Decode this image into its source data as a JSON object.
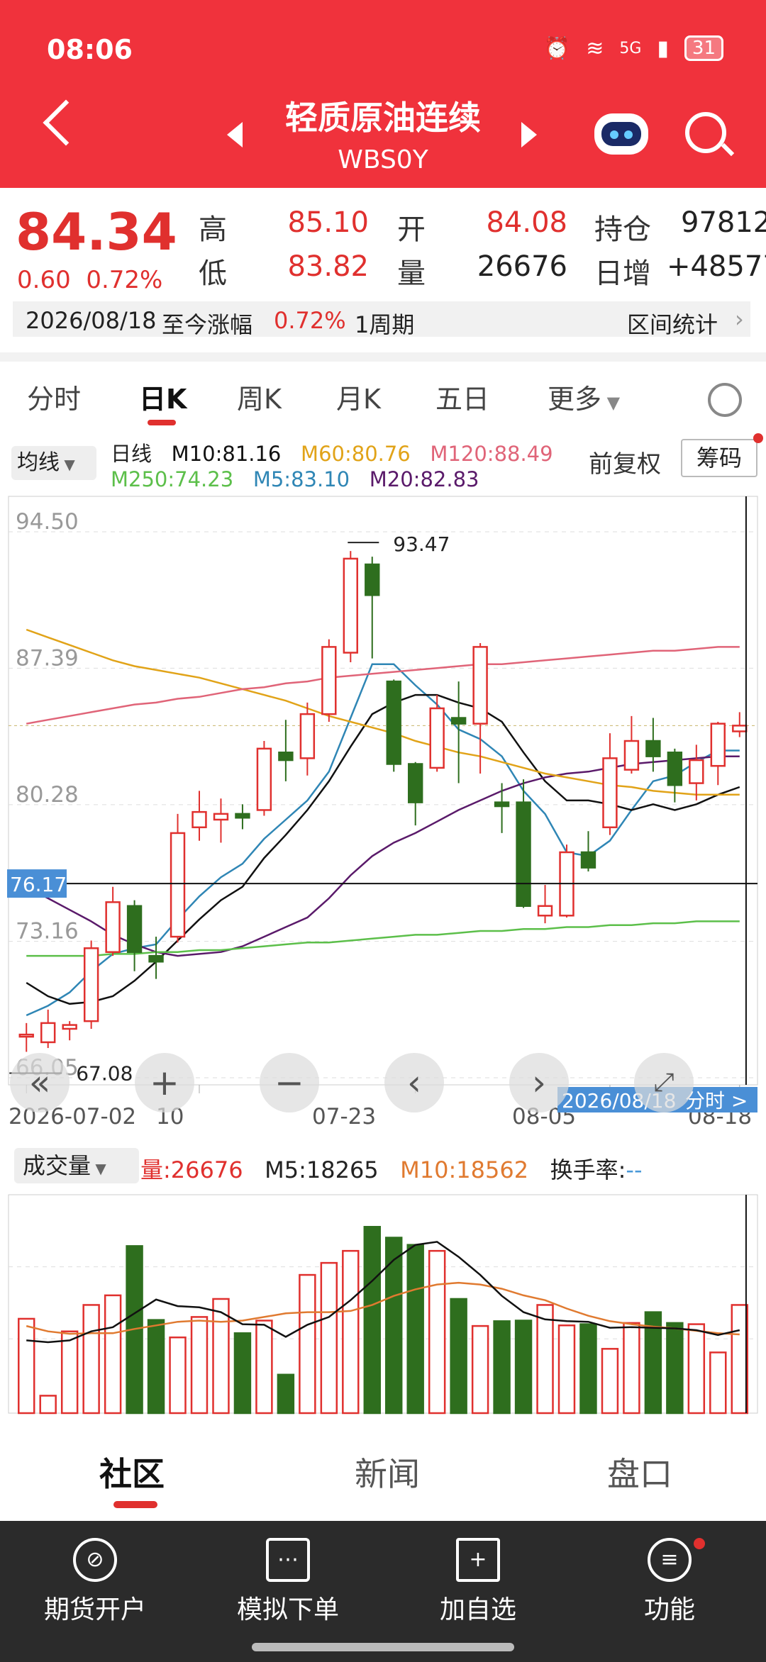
{
  "status": {
    "time": "08:06",
    "battery": "31",
    "network": "5G"
  },
  "header": {
    "title": "轻质原油连续",
    "code": "WBS0Y"
  },
  "quote": {
    "price": "84.34",
    "change": "0.60",
    "change_pct": "0.72%",
    "high_label": "高",
    "high": "85.10",
    "low_label": "低",
    "low": "83.82",
    "open_label": "开",
    "open": "84.08",
    "volume_label": "量",
    "volume": "26676",
    "oi_label": "持仓",
    "oi": "97812",
    "daily_add_label": "日增",
    "daily_add": "+48577",
    "range_date": "2026/08/18",
    "range_text": "至今涨幅",
    "range_pct": "0.72%",
    "range_period": "1周期",
    "range_stats": "区间统计"
  },
  "tabs": [
    "分时",
    "日K",
    "周K",
    "月K",
    "五日",
    "更多"
  ],
  "ma": {
    "selector": "均线",
    "daily": "日线",
    "m10": "M10:81.16",
    "m60": "M60:80.76",
    "m120": "M120:88.49",
    "m250": "M250:74.23",
    "m5": "M5:83.10",
    "m20": "M20:82.83",
    "adjust": "前复权",
    "chips": "筹码"
  },
  "chart_data": {
    "type": "candlestick",
    "y_ticks": [
      "94.50",
      "87.39",
      "80.28",
      "73.16",
      "66.05"
    ],
    "ylim": [
      66.05,
      94.5
    ],
    "max_label": "93.47",
    "min_label": "67.08",
    "crosshair_price": "76.17",
    "x_ticks": [
      "2026-07-02",
      "10",
      "07-23",
      "08-05",
      "08-18"
    ],
    "selected_date": "2026/08/18",
    "detail_link": "分时 >",
    "candles": [
      {
        "o": 68.3,
        "c": 68.3,
        "h": 68.9,
        "l": 67.4
      },
      {
        "o": 67.9,
        "c": 68.9,
        "h": 69.6,
        "l": 67.6
      },
      {
        "o": 68.6,
        "c": 68.8,
        "h": 69.0,
        "l": 68.0
      },
      {
        "o": 69.0,
        "c": 72.8,
        "h": 73.2,
        "l": 68.6
      },
      {
        "o": 72.6,
        "c": 75.2,
        "h": 76.0,
        "l": 72.4
      },
      {
        "o": 75.0,
        "c": 72.6,
        "h": 75.3,
        "l": 71.6
      },
      {
        "o": 72.4,
        "c": 72.1,
        "h": 73.4,
        "l": 71.2
      },
      {
        "o": 73.4,
        "c": 78.8,
        "h": 79.8,
        "l": 73.1
      },
      {
        "o": 79.1,
        "c": 79.9,
        "h": 81.0,
        "l": 78.4
      },
      {
        "o": 79.5,
        "c": 79.8,
        "h": 80.6,
        "l": 78.3
      },
      {
        "o": 79.8,
        "c": 79.6,
        "h": 80.3,
        "l": 79.0
      },
      {
        "o": 80.0,
        "c": 83.2,
        "h": 83.6,
        "l": 79.7
      },
      {
        "o": 83.0,
        "c": 82.6,
        "h": 84.7,
        "l": 81.5
      },
      {
        "o": 82.7,
        "c": 85.0,
        "h": 85.6,
        "l": 81.8
      },
      {
        "o": 85.0,
        "c": 88.5,
        "h": 88.9,
        "l": 84.6
      },
      {
        "o": 88.2,
        "c": 93.1,
        "h": 93.5,
        "l": 87.7
      },
      {
        "o": 92.8,
        "c": 91.2,
        "h": 93.2,
        "l": 87.9
      },
      {
        "o": 86.7,
        "c": 82.4,
        "h": 86.8,
        "l": 82.0
      },
      {
        "o": 82.4,
        "c": 80.4,
        "h": 82.5,
        "l": 79.2
      },
      {
        "o": 82.2,
        "c": 85.3,
        "h": 86.0,
        "l": 82.0
      },
      {
        "o": 84.8,
        "c": 84.5,
        "h": 86.7,
        "l": 81.4
      },
      {
        "o": 84.5,
        "c": 88.5,
        "h": 88.7,
        "l": 81.9
      },
      {
        "o": 80.4,
        "c": 80.2,
        "h": 81.4,
        "l": 78.8
      },
      {
        "o": 80.4,
        "c": 75.0,
        "h": 81.6,
        "l": 74.9
      },
      {
        "o": 74.5,
        "c": 75.0,
        "h": 76.1,
        "l": 74.1
      },
      {
        "o": 74.5,
        "c": 77.8,
        "h": 78.2,
        "l": 74.4
      },
      {
        "o": 77.8,
        "c": 77.0,
        "h": 78.9,
        "l": 76.8
      },
      {
        "o": 79.1,
        "c": 82.7,
        "h": 84.0,
        "l": 78.7
      },
      {
        "o": 82.1,
        "c": 83.6,
        "h": 84.9,
        "l": 81.9
      },
      {
        "o": 83.6,
        "c": 82.8,
        "h": 84.8,
        "l": 82.0
      },
      {
        "o": 83.0,
        "c": 81.3,
        "h": 83.2,
        "l": 80.4
      },
      {
        "o": 81.4,
        "c": 82.6,
        "h": 83.4,
        "l": 80.5
      },
      {
        "o": 82.3,
        "c": 84.5,
        "h": 84.6,
        "l": 81.3
      },
      {
        "o": 84.1,
        "c": 84.4,
        "h": 85.1,
        "l": 83.8
      }
    ],
    "ma_lines": [
      {
        "name": "M5",
        "color": "#2f86b5",
        "values": [
          69.3,
          69.8,
          70.5,
          71.6,
          72.5,
          72.8,
          73.0,
          74.3,
          75.5,
          76.5,
          77.2,
          78.5,
          79.5,
          80.5,
          82.0,
          84.8,
          87.6,
          87.6,
          86.5,
          85.5,
          84.2,
          83.7,
          82.8,
          81.0,
          79.8,
          77.8,
          77.6,
          78.4,
          80.0,
          81.5,
          81.8,
          82.5,
          83.1,
          83.1
        ]
      },
      {
        "name": "M10",
        "color": "#111111",
        "values": [
          71.0,
          70.3,
          69.9,
          70.0,
          70.3,
          71.1,
          72.1,
          73.2,
          74.3,
          75.3,
          76.0,
          77.5,
          78.7,
          80.0,
          81.5,
          83.3,
          85.0,
          85.6,
          86.0,
          86.0,
          85.6,
          85.3,
          84.6,
          83.0,
          81.5,
          80.5,
          80.5,
          80.3,
          80.0,
          80.3,
          80.0,
          80.3,
          80.8,
          81.2
        ]
      },
      {
        "name": "M20",
        "color": "#5a1a6a",
        "values": [
          76.0,
          75.4,
          74.8,
          74.2,
          73.5,
          73.0,
          72.6,
          72.4,
          72.5,
          72.6,
          72.9,
          73.4,
          73.9,
          74.4,
          75.4,
          76.6,
          77.6,
          78.3,
          78.8,
          79.4,
          80.0,
          80.5,
          81.0,
          81.4,
          81.7,
          81.9,
          82.0,
          82.2,
          82.4,
          82.5,
          82.6,
          82.7,
          82.8,
          82.8
        ]
      },
      {
        "name": "M60",
        "color": "#e1a318",
        "values": [
          89.4,
          89.0,
          88.6,
          88.2,
          87.8,
          87.5,
          87.3,
          87.1,
          86.9,
          86.6,
          86.3,
          86.0,
          85.7,
          85.3,
          84.9,
          84.6,
          84.3,
          84.0,
          83.6,
          83.3,
          83.0,
          82.8,
          82.5,
          82.2,
          81.9,
          81.7,
          81.5,
          81.3,
          81.2,
          81.0,
          80.9,
          80.8,
          80.8,
          80.8
        ]
      },
      {
        "name": "M120",
        "color": "#e06478",
        "values": [
          84.5,
          84.7,
          84.9,
          85.1,
          85.3,
          85.5,
          85.6,
          85.8,
          85.9,
          86.1,
          86.3,
          86.4,
          86.6,
          86.7,
          86.9,
          87.0,
          87.1,
          87.2,
          87.3,
          87.4,
          87.5,
          87.6,
          87.6,
          87.7,
          87.8,
          87.9,
          88.0,
          88.1,
          88.2,
          88.3,
          88.3,
          88.4,
          88.5,
          88.5
        ]
      },
      {
        "name": "M250",
        "color": "#5cbf4a",
        "values": [
          72.4,
          72.4,
          72.4,
          72.4,
          72.5,
          72.5,
          72.6,
          72.6,
          72.7,
          72.7,
          72.8,
          72.9,
          73.0,
          73.1,
          73.1,
          73.2,
          73.3,
          73.4,
          73.5,
          73.5,
          73.6,
          73.7,
          73.7,
          73.8,
          73.8,
          73.9,
          73.9,
          74.0,
          74.0,
          74.1,
          74.1,
          74.2,
          74.2,
          74.2
        ]
      }
    ],
    "volume": {
      "selector": "成交量",
      "vol_label": "量:26676",
      "m5_label": "M5:18265",
      "m10_label": "M10:18562",
      "turnover_label": "换手率:",
      "turnover_value": "--",
      "values": [
        15700,
        2900,
        13600,
        18000,
        19600,
        27800,
        15500,
        12600,
        16000,
        19000,
        13300,
        15400,
        6400,
        23000,
        25000,
        27000,
        31000,
        29200,
        28000,
        27000,
        19000,
        14500,
        15300,
        15400,
        18000,
        14600,
        14800,
        10700,
        15000,
        16800,
        15000,
        14800,
        10100,
        18000
      ],
      "m5": [
        12100,
        11800,
        12100,
        13600,
        14300,
        16600,
        18900,
        17800,
        17600,
        16800,
        14800,
        14700,
        12700,
        14700,
        16000,
        18800,
        22000,
        25500,
        28000,
        28500,
        26000,
        23000,
        19500,
        16800,
        15600,
        15300,
        15200,
        14200,
        14300,
        14200,
        14100,
        13800,
        13000,
        13800
      ],
      "m10": [
        14500,
        13600,
        13200,
        13300,
        13300,
        14000,
        14600,
        15200,
        15400,
        15200,
        15400,
        16000,
        16600,
        16800,
        16800,
        17000,
        18000,
        19500,
        20600,
        21400,
        21700,
        21400,
        20700,
        19600,
        18800,
        17400,
        16200,
        15300,
        14800,
        14400,
        14100,
        13700,
        13300,
        13100
      ]
    }
  },
  "lower_tabs": [
    "社区",
    "新闻",
    "盘口"
  ],
  "nav": [
    "期货开户",
    "模拟下单",
    "加自选",
    "功能"
  ],
  "colors": {
    "accent": "#f0323c",
    "up": "#e0302e",
    "down": "#2e6e1e"
  }
}
